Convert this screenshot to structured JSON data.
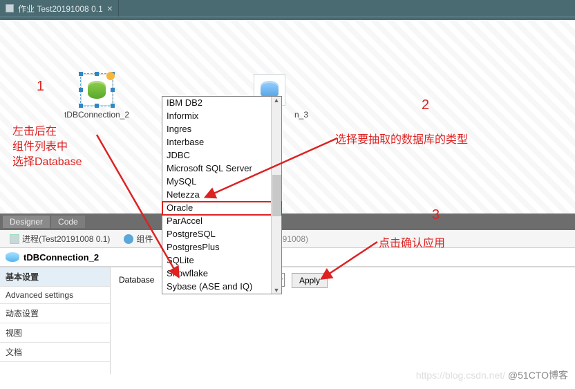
{
  "titlebar": {
    "tab_label": "作业 Test20191008 0.1",
    "close_glyph": "×"
  },
  "canvas": {
    "component1": {
      "label": "tDBConnection_2"
    },
    "component2": {
      "label_suffix": "n_3"
    }
  },
  "midtabs": {
    "designer": "Designer",
    "code": "Code"
  },
  "infobar": {
    "process_label": "进程(Test20191008 0.1)",
    "component_tab": "组件",
    "id_fragment": "0191008)"
  },
  "selection": {
    "name": "tDBConnection_2"
  },
  "sidebar": {
    "basic": "基本设置",
    "advanced": "Advanced settings",
    "dynamic": "动态设置",
    "view": "视图",
    "docs": "文档"
  },
  "property": {
    "database_label": "Database",
    "apply_label": "Apply"
  },
  "dropdown": {
    "options": [
      "IBM DB2",
      "Informix",
      "Ingres",
      "Interbase",
      "JDBC",
      "Microsoft SQL Server",
      "MySQL",
      "Netezza",
      "Oracle",
      "ParAccel",
      "PostgreSQL",
      "PostgresPlus",
      "SQLite",
      "Snowflake",
      "Sybase (ASE and IQ)"
    ],
    "highlighted": "Oracle"
  },
  "annotations": {
    "n1": "1",
    "n2": "2",
    "n3": "3",
    "t1a": "左击后在",
    "t1b": "组件列表中",
    "t1c": "选择Database",
    "t2": "选择要抽取的数据库的类型",
    "t3": "点击确认应用"
  },
  "watermark": {
    "left": "https://blog.csdn.net/",
    "right": "@51CTO博客"
  }
}
